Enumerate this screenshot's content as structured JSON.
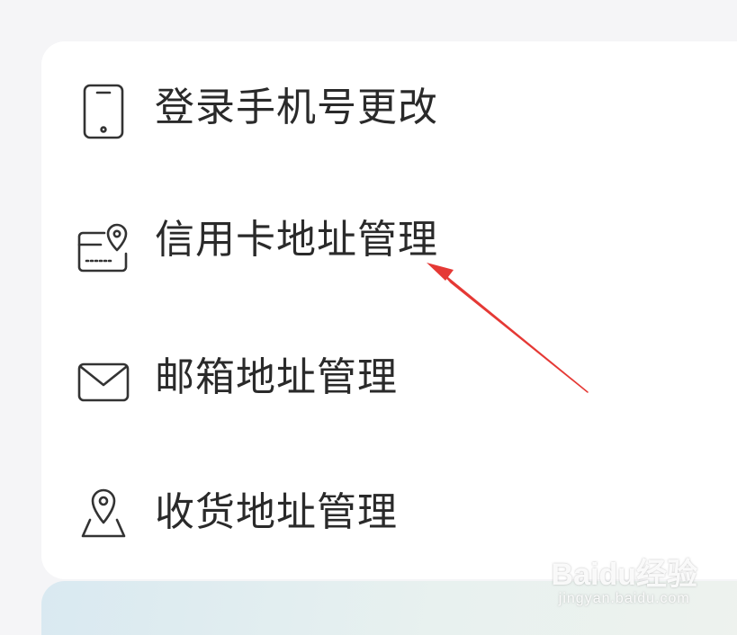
{
  "menu": {
    "items": [
      {
        "label": "登录手机号更改",
        "icon": "phone-icon"
      },
      {
        "label": "信用卡地址管理",
        "icon": "credit-card-location-icon"
      },
      {
        "label": "邮箱地址管理",
        "icon": "mail-icon"
      },
      {
        "label": "收货地址管理",
        "icon": "map-pin-icon"
      }
    ]
  },
  "annotation": {
    "arrow_color": "#e53935",
    "points_to": "信用卡地址管理"
  },
  "watermark": {
    "main": "Baidu经验",
    "sub": "jingyan.baidu.com"
  },
  "colors": {
    "page_background": "#f5f5f7",
    "card_background": "#ffffff",
    "text": "#2a2a2a",
    "icon_stroke": "#333333"
  }
}
